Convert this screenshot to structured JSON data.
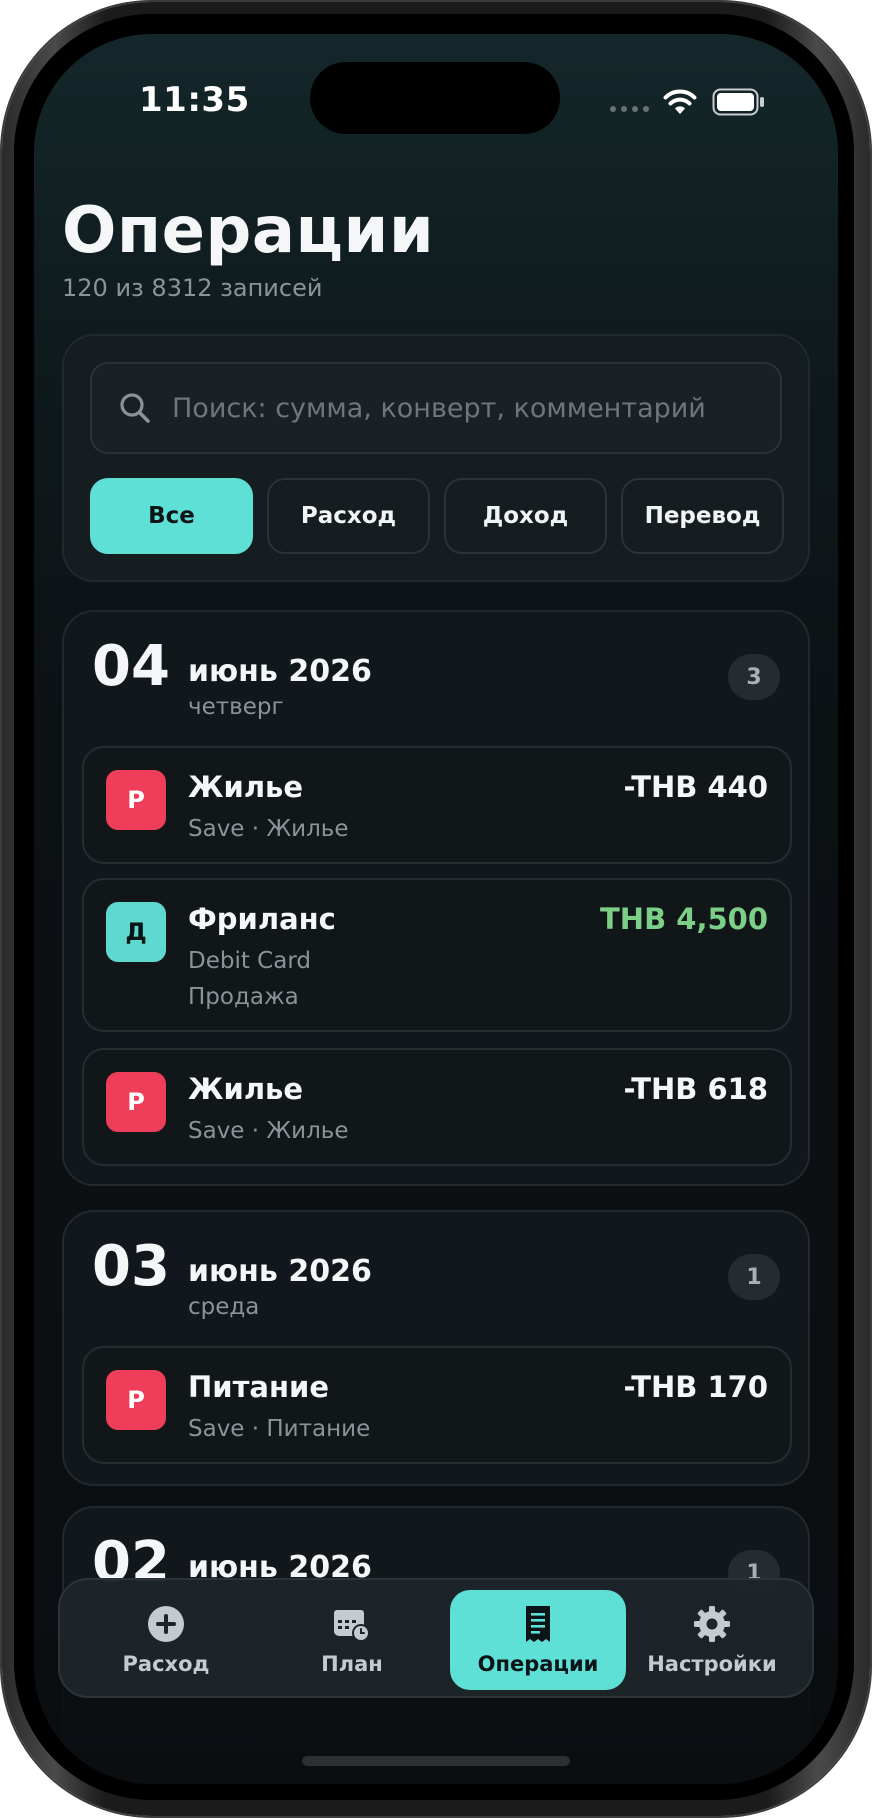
{
  "status_bar": {
    "time": "11:35"
  },
  "header": {
    "title": "Операции",
    "subtitle": "120 из 8312 записей"
  },
  "search": {
    "placeholder": "Поиск: сумма, конверт, комментарий"
  },
  "filters": [
    {
      "label": "Все",
      "active": true
    },
    {
      "label": "Расход",
      "active": false
    },
    {
      "label": "Доход",
      "active": false
    },
    {
      "label": "Перевод",
      "active": false
    }
  ],
  "days": [
    {
      "day": "04",
      "month": "июнь 2026",
      "weekday": "четверг",
      "count": "3",
      "transactions": [
        {
          "badge": "Р",
          "type": "expense",
          "title": "Жилье",
          "line1": "Save · Жилье",
          "amount": "-THB 440"
        },
        {
          "badge": "Д",
          "type": "income",
          "title": "Фриланс",
          "line1": "Debit Card",
          "line2": "Продажа",
          "amount": "THB 4,500"
        },
        {
          "badge": "Р",
          "type": "expense",
          "title": "Жилье",
          "line1": "Save · Жилье",
          "amount": "-THB 618"
        }
      ]
    },
    {
      "day": "03",
      "month": "июнь 2026",
      "weekday": "среда",
      "count": "1",
      "transactions": [
        {
          "badge": "Р",
          "type": "expense",
          "title": "Питание",
          "line1": "Save · Питание",
          "amount": "-THB 170"
        }
      ]
    },
    {
      "day": "02",
      "month": "июнь 2026",
      "count": "1"
    }
  ],
  "bottom_nav": [
    {
      "label": "Расход",
      "icon": "plus-circle-icon",
      "active": false
    },
    {
      "label": "План",
      "icon": "calendar-clock-icon",
      "active": false
    },
    {
      "label": "Операции",
      "icon": "receipt-icon",
      "active": true
    },
    {
      "label": "Настройки",
      "icon": "gear-icon",
      "active": false
    }
  ],
  "colors": {
    "accent": "#5fe0d7",
    "expense_badge": "#ee3e5a",
    "income_badge": "#5fd8d0",
    "income_amount": "#7ccf86",
    "background": "#0b0e11"
  }
}
